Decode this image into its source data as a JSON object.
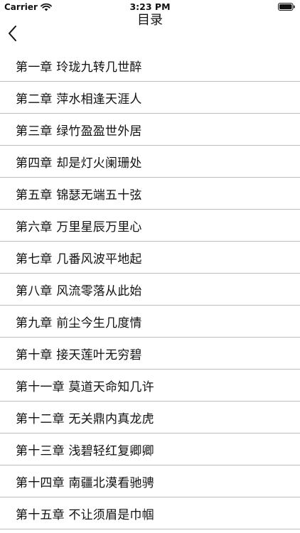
{
  "status_bar": {
    "carrier": "Carrier",
    "time": "3:23 PM"
  },
  "nav": {
    "title": "目录",
    "back_icon": "chevron-left-icon"
  },
  "chapters": [
    {
      "label": "第一章 玲珑九转几世醉"
    },
    {
      "label": "第二章 萍水相逢天涯人"
    },
    {
      "label": "第三章 绿竹盈盈世外居"
    },
    {
      "label": "第四章 却是灯火阑珊处"
    },
    {
      "label": "第五章 锦瑟无端五十弦"
    },
    {
      "label": "第六章 万里星辰万里心"
    },
    {
      "label": "第七章 几番风波平地起"
    },
    {
      "label": "第八章 风流零落从此始"
    },
    {
      "label": "第九章 前尘今生几度情"
    },
    {
      "label": "第十章 接天莲叶无穷碧"
    },
    {
      "label": "第十一章 莫道天命知几许"
    },
    {
      "label": "第十二章 无关鼎内真龙虎"
    },
    {
      "label": "第十三章 浅碧轻红复卿卿"
    },
    {
      "label": "第十四章 南疆北漠看驰骋"
    },
    {
      "label": "第十五章 不让须眉是巾帼"
    }
  ]
}
